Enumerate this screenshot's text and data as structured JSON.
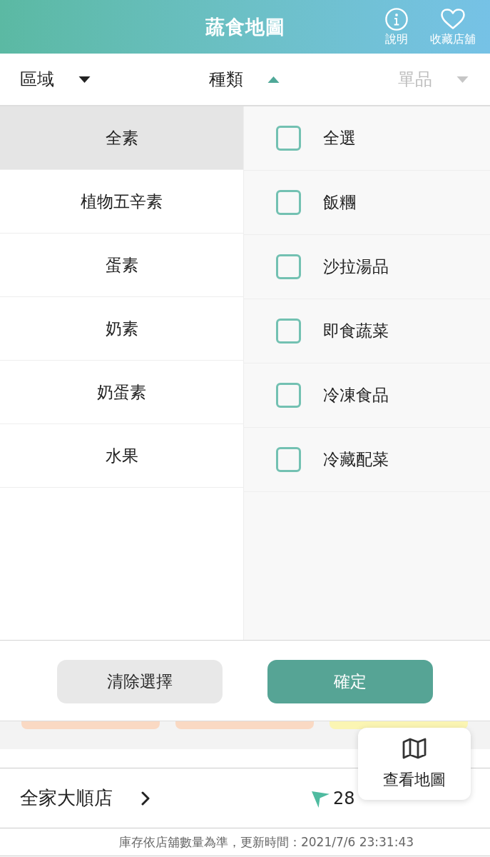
{
  "header": {
    "title": "蔬食地圖",
    "actions": [
      {
        "label": "說明",
        "kind": "info"
      },
      {
        "label": "收藏店舖",
        "kind": "heart"
      }
    ]
  },
  "filters": [
    {
      "label": "區域",
      "expanded": false,
      "disabled": false
    },
    {
      "label": "種類",
      "expanded": true,
      "disabled": false
    },
    {
      "label": "單品",
      "expanded": false,
      "disabled": true
    }
  ],
  "categories": [
    {
      "label": "全素",
      "selected": true
    },
    {
      "label": "植物五辛素",
      "selected": false
    },
    {
      "label": "蛋素",
      "selected": false
    },
    {
      "label": "奶素",
      "selected": false
    },
    {
      "label": "奶蛋素",
      "selected": false
    },
    {
      "label": "水果",
      "selected": false
    }
  ],
  "options": [
    {
      "label": "全選",
      "checked": false
    },
    {
      "label": "飯糰",
      "checked": false
    },
    {
      "label": "沙拉湯品",
      "checked": false
    },
    {
      "label": "即食蔬菜",
      "checked": false
    },
    {
      "label": "冷凍食品",
      "checked": false
    },
    {
      "label": "冷藏配菜",
      "checked": false
    }
  ],
  "buttons": [
    {
      "label": "清除選擇",
      "kind": "secondary"
    },
    {
      "label": "確定",
      "kind": "primary"
    }
  ],
  "tag_chips": [
    {
      "color": "#fad9c3"
    },
    {
      "color": "#fad9c3"
    },
    {
      "color": "#fbf5b3"
    }
  ],
  "store": {
    "name": "全家大順店",
    "distance": "28"
  },
  "map_button": {
    "label": "查看地圖"
  },
  "footer": "庫存依店舖數量為準，更新時間：2021/7/6 23:31:43"
}
